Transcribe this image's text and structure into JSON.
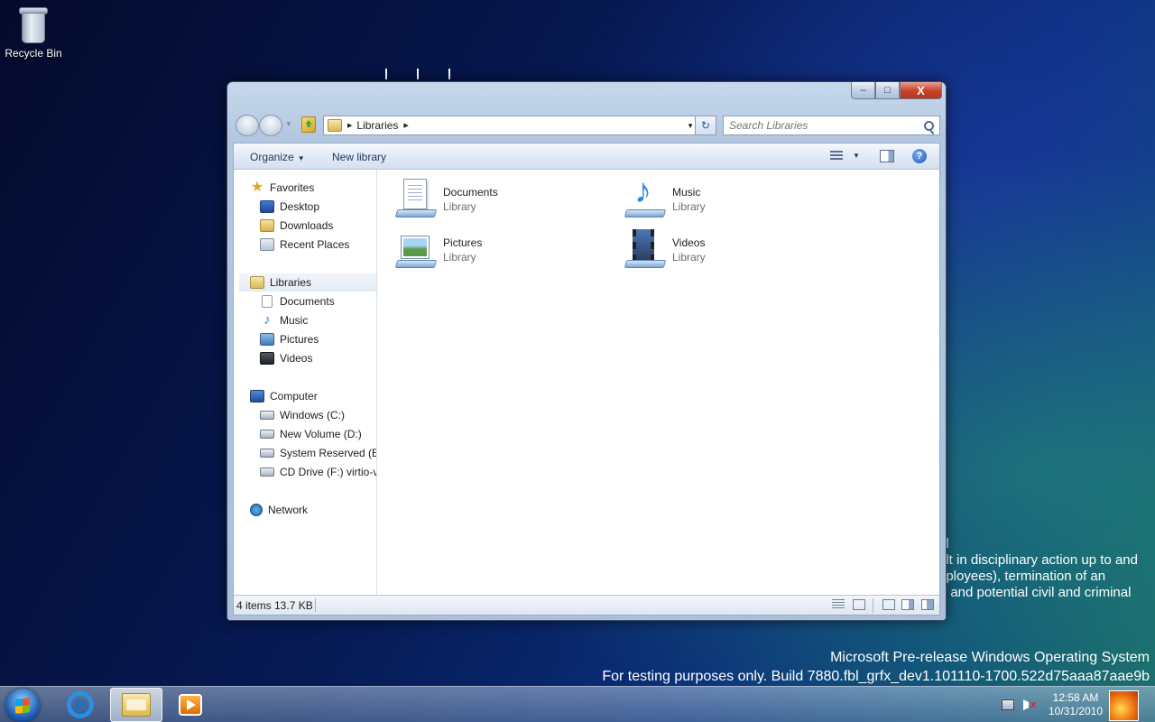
{
  "desktop": {
    "icons": [
      {
        "label": "Recycle Bin",
        "icon": "recycle-bin-icon"
      }
    ],
    "background_text": [
      "al",
      "ult in disciplinary action up to and",
      "nployees), termination of an",
      "), and potential civil and criminal"
    ],
    "watermark": {
      "line1": "Microsoft Pre-release Windows Operating System",
      "line2": "For testing purposes only. Build 7880.fbl_grfx_dev1.101110-1700.522d75aaa87aae9b"
    }
  },
  "window": {
    "caption": {
      "minimize": "–",
      "maximize": "□",
      "close": "X"
    },
    "address": {
      "icon": "libraries-icon",
      "crumbs": [
        "Libraries"
      ]
    },
    "refresh_symbol": "↻",
    "search": {
      "placeholder": "Search Libraries"
    },
    "toolbar": {
      "organize": "Organize",
      "new_library": "New library",
      "help": "?"
    },
    "nav": {
      "favorites": {
        "label": "Favorites",
        "items": [
          "Desktop",
          "Downloads",
          "Recent Places"
        ]
      },
      "libraries": {
        "label": "Libraries",
        "items": [
          "Documents",
          "Music",
          "Pictures",
          "Videos"
        ]
      },
      "computer": {
        "label": "Computer",
        "items": [
          "Windows (C:)",
          "New Volume (D:)",
          "System Reserved (E:)",
          "CD Drive (F:) virtio-v"
        ]
      },
      "network": {
        "label": "Network"
      }
    },
    "libraries": [
      {
        "name": "Documents",
        "type": "Library",
        "icon": "documents-library-icon"
      },
      {
        "name": "Music",
        "type": "Library",
        "icon": "music-library-icon"
      },
      {
        "name": "Pictures",
        "type": "Library",
        "icon": "pictures-library-icon"
      },
      {
        "name": "Videos",
        "type": "Library",
        "icon": "videos-library-icon"
      }
    ],
    "status": {
      "text": "4 items  13.7 KB"
    }
  },
  "taskbar": {
    "apps": [
      "internet-explorer",
      "windows-explorer",
      "windows-media-player"
    ],
    "active_app": "windows-explorer",
    "clock": {
      "time": "12:58 AM",
      "date": "10/31/2010"
    }
  }
}
